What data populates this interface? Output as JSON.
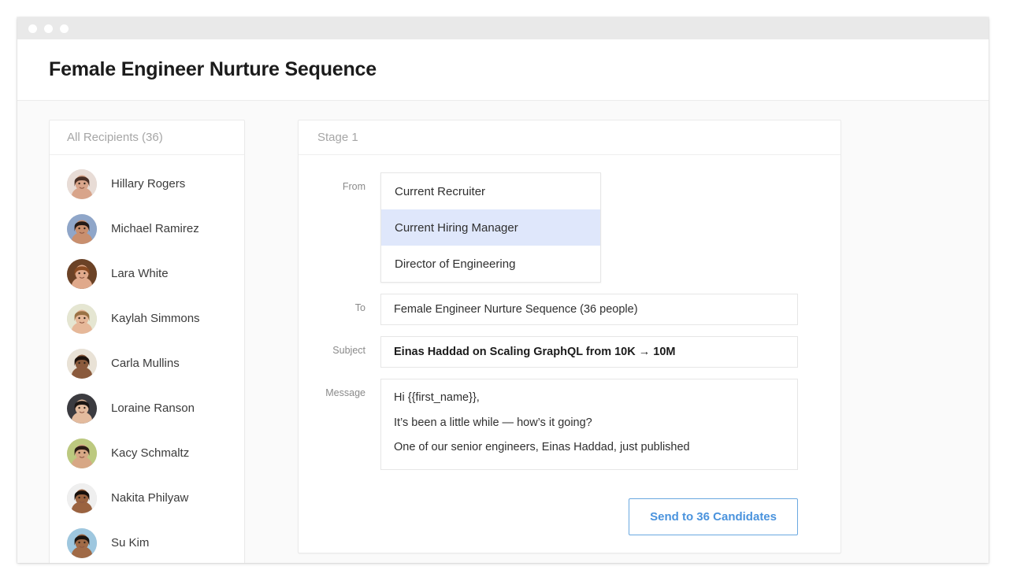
{
  "window": {
    "traffic_lights": [
      "close-dot",
      "minimize-dot",
      "maximize-dot"
    ]
  },
  "header": {
    "title": "Female Engineer Nurture Sequence"
  },
  "recipients": {
    "header_label": "All Recipients (36)",
    "count": 36,
    "items": [
      {
        "name": "Hillary Rogers",
        "skin": "#d8a48a",
        "hair": "#4a3026",
        "bg": "#e8dcd6"
      },
      {
        "name": "Michael Ramirez",
        "skin": "#c98f6e",
        "hair": "#241a16",
        "bg": "#8fa6c9"
      },
      {
        "name": "Lara White",
        "skin": "#e0a98b",
        "hair": "#8a4b22",
        "bg": "#6b4226"
      },
      {
        "name": "Kaylah Simmons",
        "skin": "#e6b899",
        "hair": "#9a7245",
        "bg": "#e5e6d2"
      },
      {
        "name": "Carla Mullins",
        "skin": "#8a5a3c",
        "hair": "#1d120c",
        "bg": "#e9e2d6"
      },
      {
        "name": "Loraine Ranson",
        "skin": "#e3bb9e",
        "hair": "#1b1512",
        "bg": "#3b3b40"
      },
      {
        "name": "Kacy Schmaltz",
        "skin": "#d7a785",
        "hair": "#2a1c15",
        "bg": "#bcc97f"
      },
      {
        "name": "Nakita Philyaw",
        "skin": "#9a6340",
        "hair": "#17100c",
        "bg": "#efefef"
      },
      {
        "name": "Su Kim",
        "skin": "#a06a46",
        "hair": "#1a1410",
        "bg": "#9ec7df"
      }
    ]
  },
  "stage": {
    "header_label": "Stage 1",
    "fields": {
      "from": {
        "label": "From",
        "options": [
          "Current Recruiter",
          "Current Hiring Manager",
          "Director of Engineering"
        ],
        "selected_index": 1,
        "selected_value": "Current Hiring Manager"
      },
      "to": {
        "label": "To",
        "value": "Female Engineer Nurture Sequence (36 people)"
      },
      "subject": {
        "label": "Subject",
        "value": "Einas Haddad on Scaling GraphQL from 10K → 10M"
      },
      "message": {
        "label": "Message",
        "lines": [
          "Hi {{first_name}},",
          "It’s been a little while — how’s it going?",
          "One of our senior engineers, Einas Haddad, just published"
        ]
      }
    },
    "send_button_label": "Send to 36 Candidates"
  },
  "colors": {
    "accent_blue": "#4a93dd",
    "highlight_row": "#dfe7fb",
    "titlebar": "#e9e9e9",
    "content_bg": "#fafafa"
  }
}
